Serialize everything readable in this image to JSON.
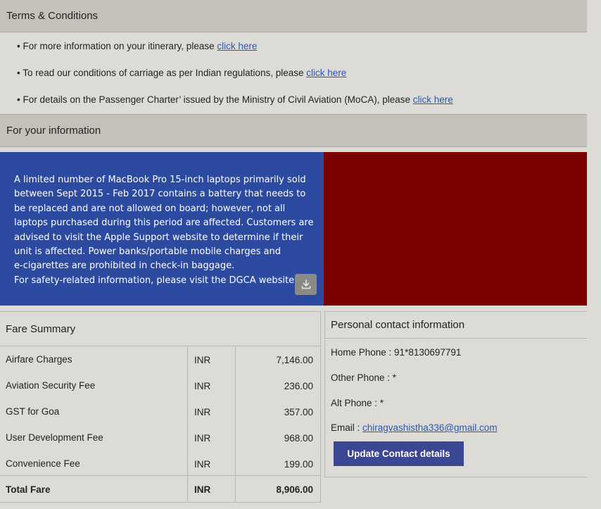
{
  "terms": {
    "header": "Terms & Conditions",
    "bullets": [
      {
        "text": "• For more information on your itinerary, please ",
        "link": "click here"
      },
      {
        "text": "• To read our conditions of carriage as per Indian regulations, please ",
        "link": "click here"
      },
      {
        "text": "• For details on the Passenger Charter’ issued by the Ministry of Civil Aviation (MoCA), please ",
        "link": "click here"
      }
    ]
  },
  "info": {
    "header": "For your information",
    "banner_lines": [
      "A limited number of MacBook Pro 15-inch laptops primarily sold",
      "between Sept 2015 - Feb 2017 contains a battery that needs to",
      "be replaced and are not allowed on board; however, not all",
      "laptops purchased during this period are affected. Customers are",
      "advised to visit the Apple Support website to determine if their",
      "unit is affected. Power banks/portable mobile charges and",
      "e-cigarettes are prohibited in check-in baggage.",
      "For safety-related information, please visit the DGCA website"
    ],
    "banner_left_color": "#2b4aa0",
    "banner_right_color": "#7d0000",
    "download_icon": "download-icon"
  },
  "fare": {
    "title": "Fare Summary",
    "rows": [
      {
        "name": "Airfare Charges",
        "currency": "INR",
        "amount": "7,146.00"
      },
      {
        "name": "Aviation Security Fee",
        "currency": "INR",
        "amount": "236.00"
      },
      {
        "name": "GST for Goa",
        "currency": "INR",
        "amount": "357.00"
      },
      {
        "name": "User Development Fee",
        "currency": "INR",
        "amount": "968.00"
      },
      {
        "name": "Convenience Fee",
        "currency": "INR",
        "amount": "199.00"
      }
    ],
    "total": {
      "name": "Total Fare",
      "currency": "INR",
      "amount": "8,906.00"
    }
  },
  "contact": {
    "title": "Personal contact information",
    "home_phone": "Home Phone : 91*8130697791",
    "other_phone": "Other Phone : *",
    "alt_phone": "Alt Phone : *",
    "email_label": "Email : ",
    "email": "chiragvashistha336@gmail.com",
    "update_button": "Update Contact details"
  }
}
